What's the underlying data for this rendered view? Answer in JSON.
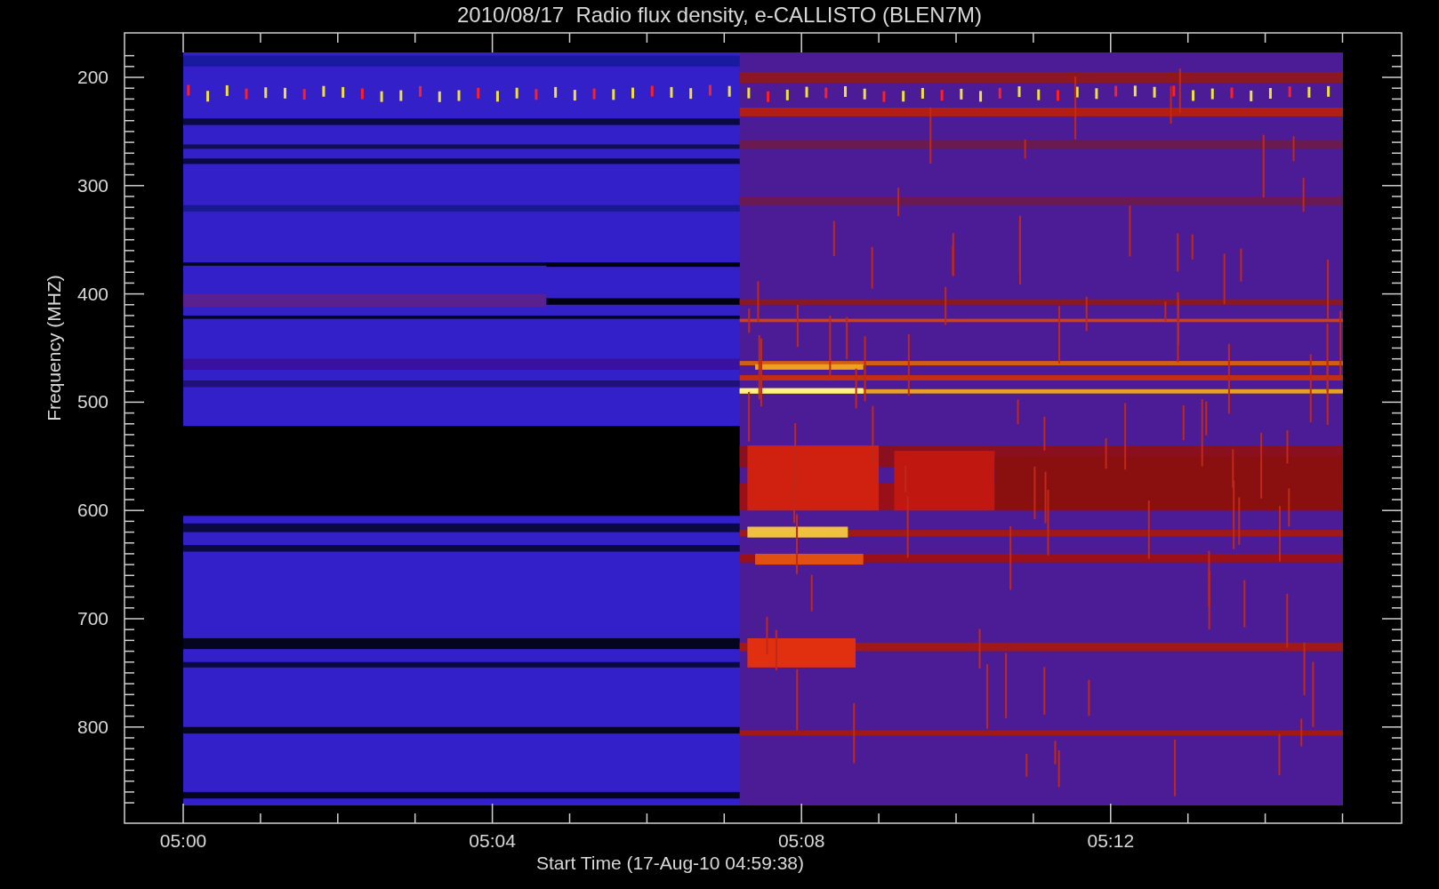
{
  "title": "2010/08/17  Radio flux density, e-CALLISTO (BLEN7M)",
  "y_axis": {
    "label": "Frequency (MHZ)",
    "ticks": [
      "200",
      "300",
      "400",
      "500",
      "600",
      "700",
      "800"
    ]
  },
  "x_axis": {
    "label": "Start Time (17-Aug-10 04:59:38)",
    "ticks": [
      "05:00",
      "05:04",
      "05:08",
      "05:12"
    ]
  }
}
